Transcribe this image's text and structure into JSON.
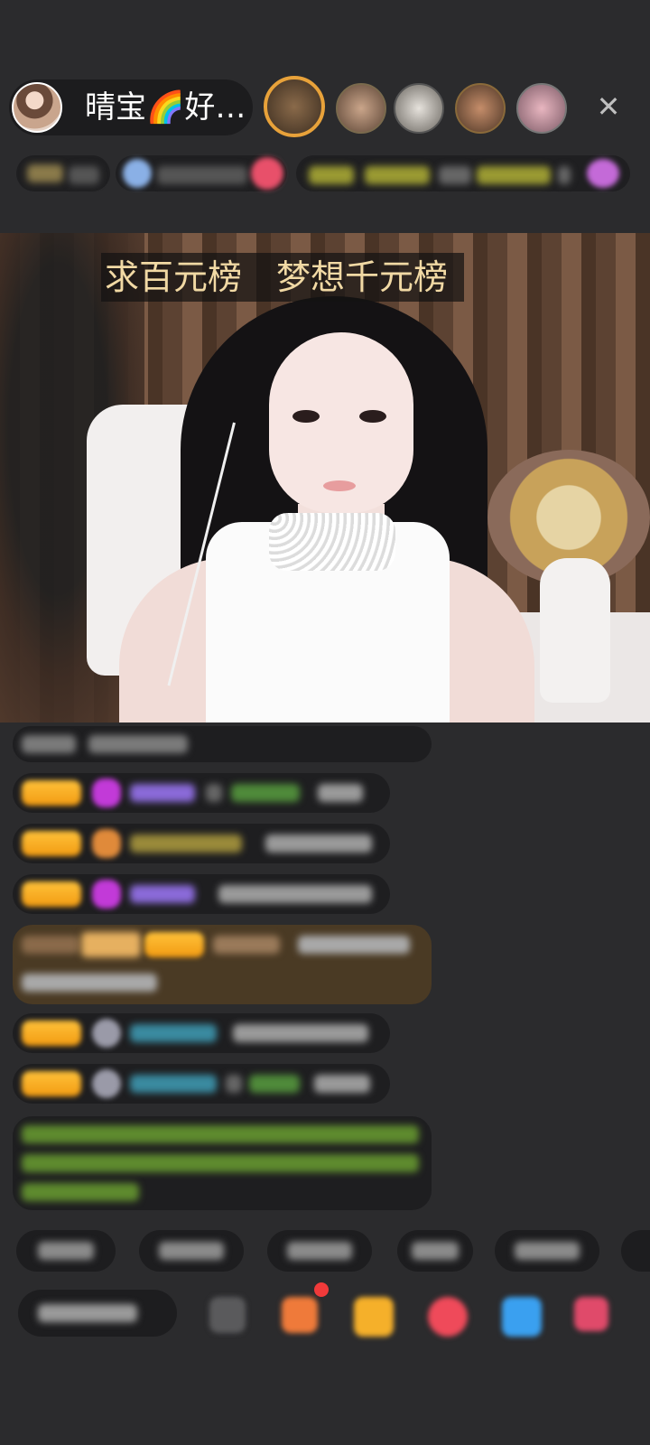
{
  "header": {
    "host_name": "晴宝🌈好…",
    "close_glyph": "✕",
    "viewers": [
      "viewer-1",
      "viewer-2",
      "viewer-3",
      "viewer-4",
      "viewer-5"
    ]
  },
  "video": {
    "banner_text": "求百元榜　梦想千元榜"
  },
  "colors": {
    "background": "#2b2b2d",
    "level_badge": "#f5a51c",
    "banner_text": "#f1d9a4",
    "featured_ring": "#e8a23a",
    "highlight_message_bg": "#4a3a24",
    "system_text_green": "#7fbf3a"
  },
  "icons": {
    "close": "close-icon",
    "gift": "gift-icon",
    "emoji": "emoji-icon",
    "box": "box-icon",
    "heart": "heart-icon",
    "game": "game-icon",
    "grid": "grid-icon"
  }
}
